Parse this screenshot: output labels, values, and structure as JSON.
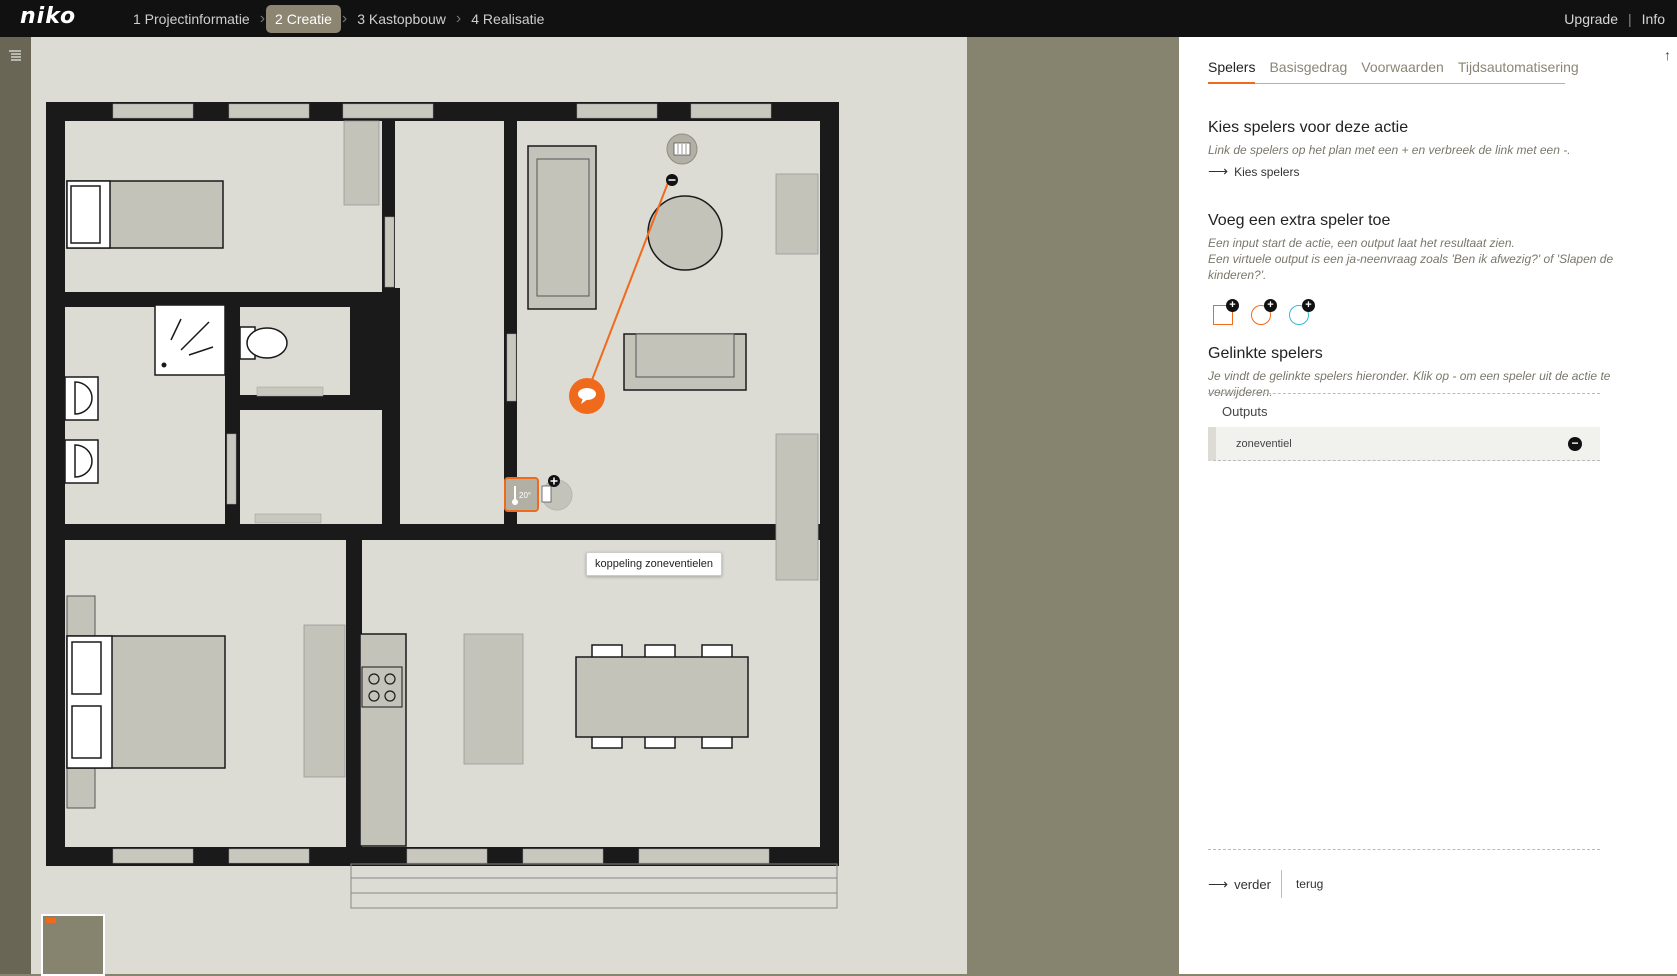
{
  "app": {
    "logo": "niko"
  },
  "nav": {
    "steps": [
      {
        "label": "1 Projectinformatie"
      },
      {
        "label": "2 Creatie"
      },
      {
        "label": "3 Kastopbouw"
      },
      {
        "label": "4 Realisatie"
      }
    ],
    "active_step": 1,
    "upgrade": "Upgrade",
    "info": "Info"
  },
  "panel": {
    "tabs": [
      {
        "label": "Spelers"
      },
      {
        "label": "Basisgedrag"
      },
      {
        "label": "Voorwaarden"
      },
      {
        "label": "Tijdsautomatisering"
      }
    ],
    "active_tab": 0,
    "choose": {
      "title": "Kies spelers voor deze actie",
      "desc": "Link de spelers op het plan met een + en verbreek de link met een -.",
      "link": "Kies spelers"
    },
    "extra": {
      "title": "Voeg een extra speler toe",
      "desc1": "Een input start de actie, een output laat het resultaat zien.",
      "desc2": "Een virtuele output is een ja-neenvraag zoals 'Ben ik afwezig?' of 'Slapen de kinderen?'."
    },
    "linked": {
      "title": "Gelinkte spelers",
      "desc": "Je vindt de gelinkte spelers hieronder. Klik op - om een speler uit de actie te verwijderen.",
      "outputs_label": "Outputs",
      "rows": [
        {
          "label": "zoneventiel"
        }
      ]
    },
    "footer": {
      "next": "verder",
      "back": "terug"
    }
  },
  "plan": {
    "tooltip": "koppeling zoneventielen",
    "thermostat_value": "20°"
  },
  "colors": {
    "accent": "#f06a1c",
    "wall": "#1a1a1a",
    "floor": "#dcdcd5",
    "furniture": "#c4c3ba"
  }
}
